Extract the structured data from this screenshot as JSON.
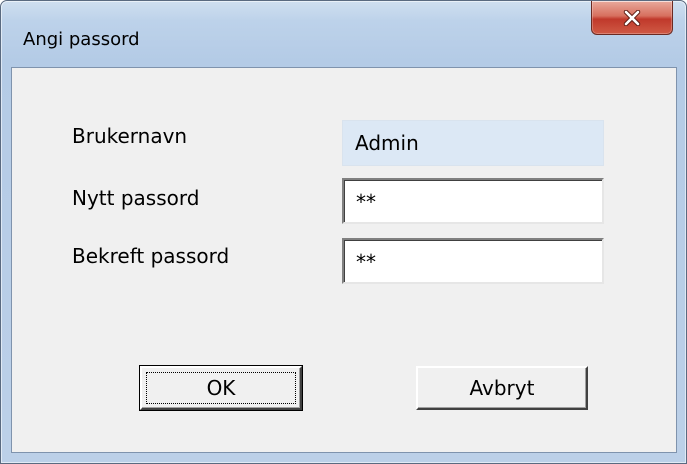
{
  "window": {
    "title": "Angi passord",
    "close_icon": "close-icon"
  },
  "form": {
    "username_label": "Brukernavn",
    "username_value": "Admin",
    "new_password_label": "Nytt passord",
    "new_password_value": "**",
    "confirm_password_label": "Bekreft passord",
    "confirm_password_value": "**"
  },
  "buttons": {
    "ok_label": "OK",
    "cancel_label": "Avbryt"
  },
  "colors": {
    "frame_accent": "#bdd2ea",
    "close_button": "#c0392b",
    "readonly_field": "#dce8f5"
  }
}
